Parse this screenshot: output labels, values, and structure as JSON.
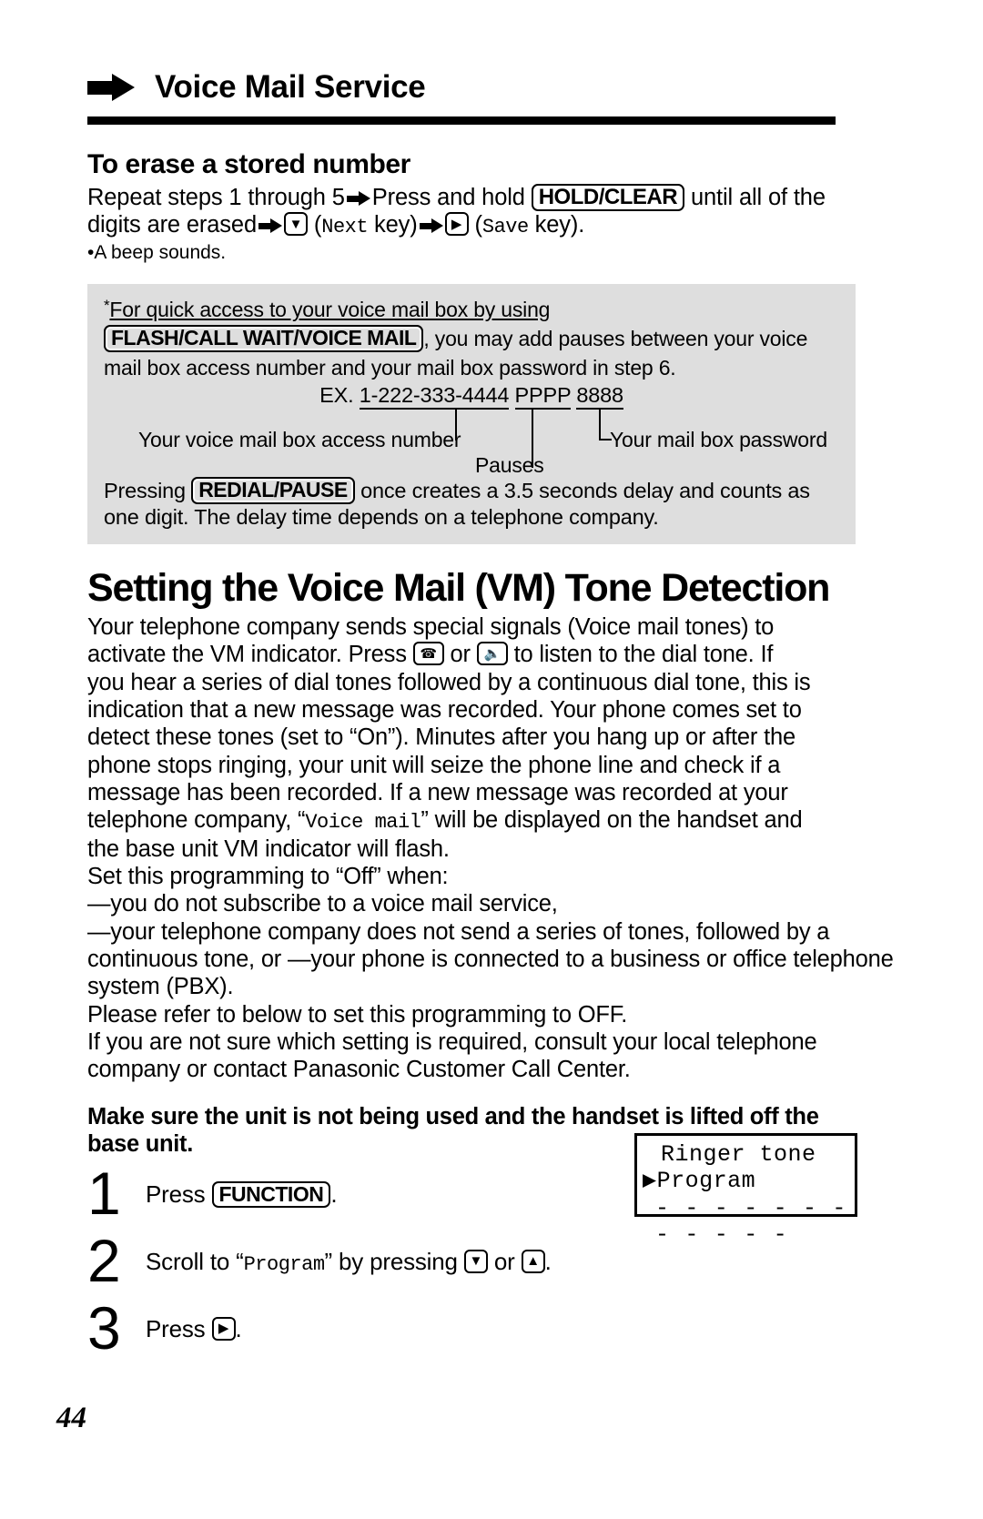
{
  "running_head": {
    "arrow_icon": "right-arrow-icon",
    "title": "Voice Mail Service"
  },
  "erase_section": {
    "heading": "To erase a stored number",
    "line1_a": "Repeat steps 1 through 5",
    "line1_b": "Press and hold",
    "key_hold_clear": "HOLD/CLEAR",
    "line1_c": "until all of the",
    "line2_a": "digits are erased",
    "key_down": "▼",
    "next_label": "Next",
    "next_suffix": "key)",
    "key_right": "▶",
    "save_label": "Save",
    "save_suffix": "key).",
    "bullet": "•A beep sounds."
  },
  "note_box": {
    "star": "*",
    "line1": "For quick access to your voice mail box by using",
    "key_flash": "FLASH/CALL WAIT/VOICE MAIL",
    "line2_tail": ", you may add pauses between your voice",
    "line3": "mail box access number and your mail box password in step 6.",
    "ex_label": "EX.",
    "ex_access_number": "1-222-333-4444",
    "ex_pauses": "PPPP",
    "ex_password": "8888",
    "callout_access": "Your voice mail box access number",
    "callout_password": "Your mail box password",
    "callout_pauses": "Pauses",
    "tail_a": "Pressing",
    "key_redial": "REDIAL/PAUSE",
    "tail_b": "once creates a 3.5 seconds delay and counts as",
    "tail_c": "one digit. The delay time depends on a telephone company."
  },
  "vm_section": {
    "heading": "Setting the Voice Mail (VM) Tone Detection",
    "p1_a": "Your telephone company sends special signals (Voice mail tones) to",
    "p1_b": "activate the VM indicator. Press",
    "icon_handset": "handset-icon",
    "p1_or": "or",
    "icon_speaker": "speakerphone-icon",
    "p1_c": "to listen to the dial tone. If",
    "p1_d": "you hear a series of dial tones followed by a continuous dial tone, this is",
    "p1_e": "indication that a new message was recorded. Your phone comes set to",
    "p1_f": "detect these tones (set to “On”). Minutes after you hang up or after the",
    "p1_g": "phone stops ringing, your unit will seize the phone line and check if a",
    "p1_h": "message has been recorded. If a new message was recorded at your",
    "p1_i": "telephone company,",
    "display_voice_mail": "Voice mail",
    "p1_j": "will be displayed on the handset and",
    "p1_k": "the base unit VM indicator will flash.",
    "set_off_intro": "Set this programming to “Off” when:",
    "dash_items": [
      "—you do not subscribe to a voice mail service,",
      "—your telephone company does not send a series of tones, followed by a",
      "—your phone is connected to a business or office telephone system (PBX)."
    ],
    "dash2_cont": "continuous tone, or",
    "refer_line": "Please refer to below to set this programming to OFF.",
    "unsure_a": "If you are not sure which setting is required, consult your local telephone",
    "unsure_b": "company or contact Panasonic Customer Call Center.",
    "bold_note_a": "Make sure the unit is not being used and the handset is lifted off the",
    "bold_note_b": "base unit."
  },
  "steps": [
    {
      "number": "1",
      "pre": "Press",
      "key": "FUNCTION",
      "post": "."
    },
    {
      "number": "2",
      "pre": "Scroll to “",
      "mono": "Program",
      "mid": "” by pressing",
      "key_down": "▼",
      "or": "or",
      "key_up": "▲",
      "post": "."
    },
    {
      "number": "3",
      "pre": "Press",
      "key_right": "▶",
      "post": "."
    }
  ],
  "lcd": {
    "line1": "Ringer tone",
    "cursor": "▶",
    "line2": "Program",
    "line3": "- - - - - - - - - - - -"
  },
  "footer": {
    "page_number": "44"
  },
  "colors": {
    "note_box_bg": "#dedede",
    "ink": "#000000",
    "paper": "#ffffff"
  }
}
